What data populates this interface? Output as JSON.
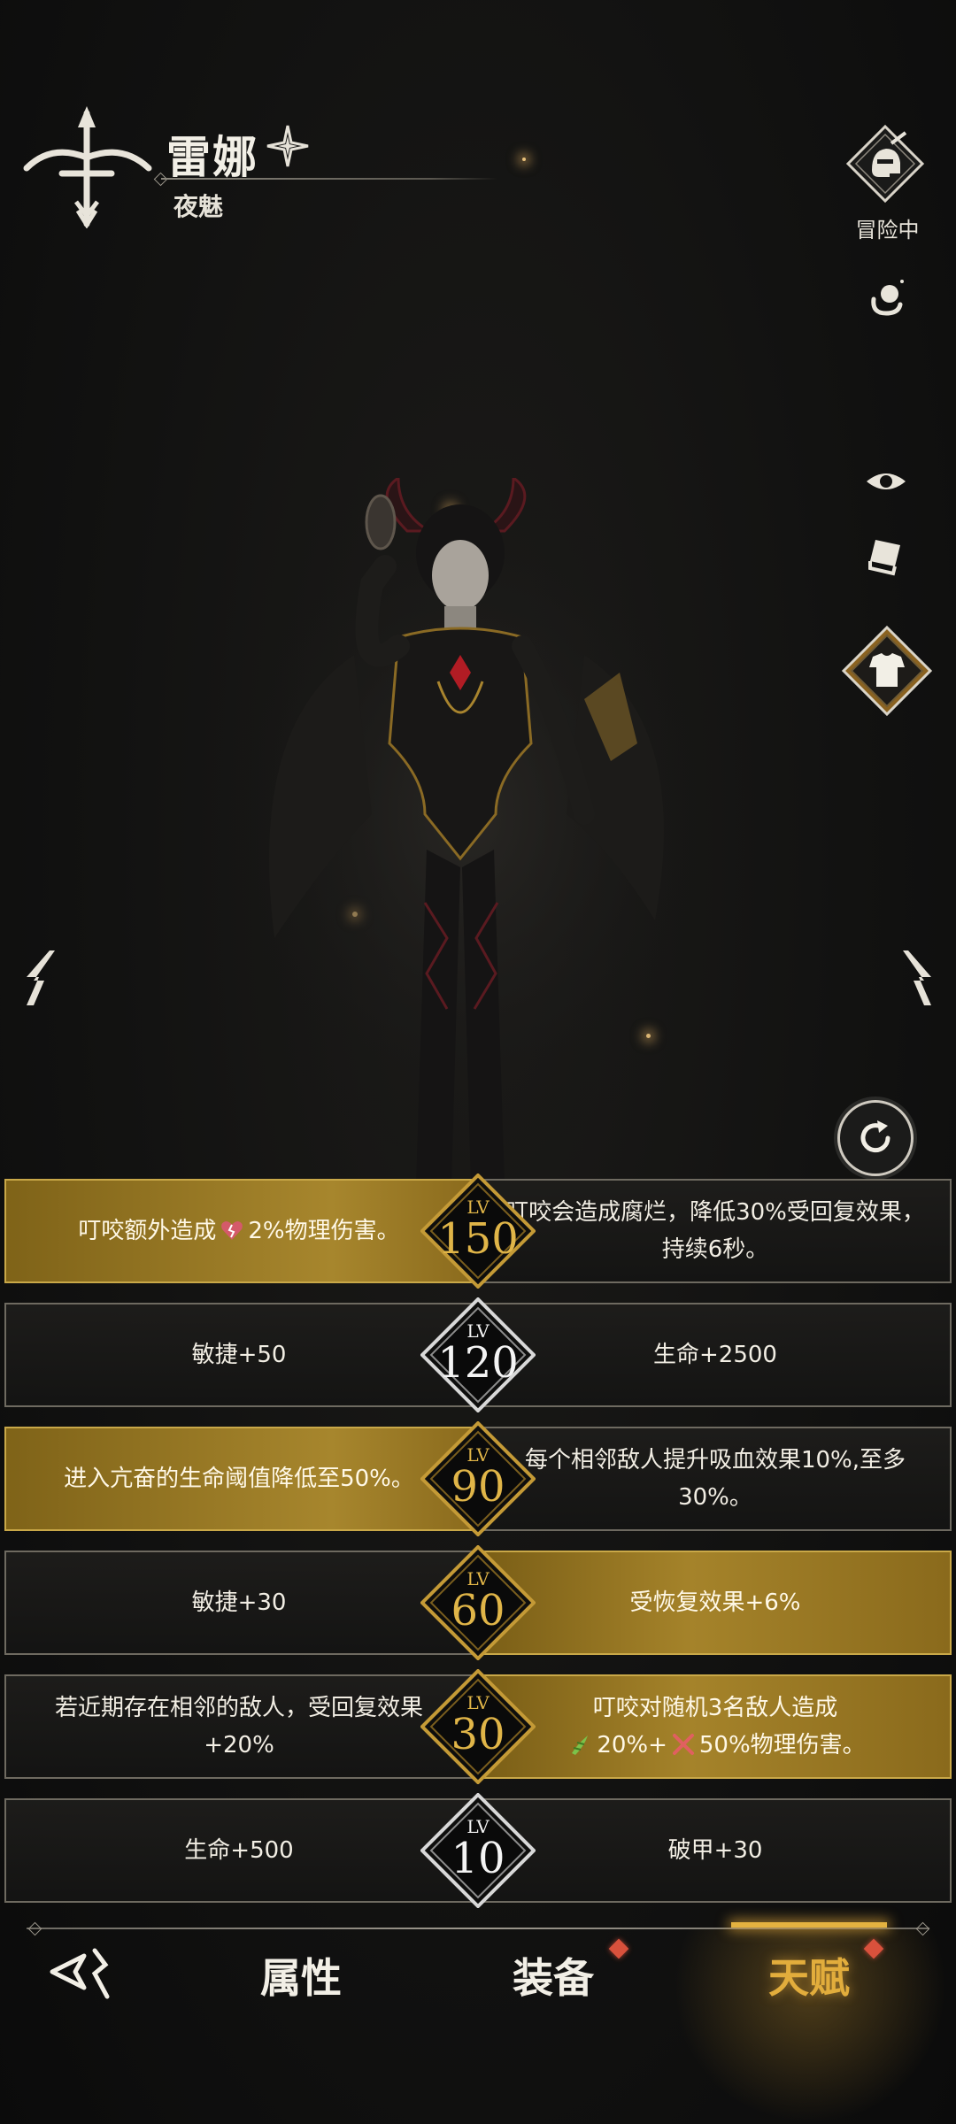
{
  "header": {
    "hero_name": "雷娜",
    "hero_title": "夜魅",
    "status_label": "冒险中"
  },
  "talents": [
    {
      "level_label": "LV",
      "level": "150",
      "left_text_before_icon": "叮咬额外造成",
      "left_text_after_icon": "2%物理伤害。",
      "left_icon": "broken-heart-icon",
      "right_text": "叮咬会造成腐烂，降低30%受回复效果，持续6秒。",
      "left_style": "gold",
      "right_style": "dark",
      "badge_style": "gold"
    },
    {
      "level_label": "LV",
      "level": "120",
      "left_text": "敏捷+50",
      "right_text": "生命+2500",
      "left_style": "dark",
      "right_style": "dark",
      "badge_style": "silver"
    },
    {
      "level_label": "LV",
      "level": "90",
      "left_text": "进入亢奋的生命阈值降低至50%。",
      "right_text": "每个相邻敌人提升吸血效果10%,至多30%。",
      "left_style": "gold",
      "right_style": "dark",
      "badge_style": "gold"
    },
    {
      "level_label": "LV",
      "level": "60",
      "left_text": "敏捷+30",
      "right_text": "受恢复效果+6%",
      "left_style": "dark",
      "right_style": "gold",
      "badge_style": "gold"
    },
    {
      "level_label": "LV",
      "level": "30",
      "left_text": "若近期存在相邻的敌人，受回复效果+20%",
      "right_text_line1": "叮咬对随机3名敌人造成",
      "right_text_part_a": "20%+",
      "right_text_part_b": "50%物理伤害。",
      "right_icon_a": "green-vine-icon",
      "right_icon_b": "red-swords-icon",
      "left_style": "dark",
      "right_style": "gold",
      "badge_style": "gold"
    },
    {
      "level_label": "LV",
      "level": "10",
      "left_text": "生命+500",
      "right_text": "破甲+30",
      "left_style": "dark",
      "right_style": "dark",
      "badge_style": "silver"
    }
  ],
  "tabs": [
    {
      "label": "属性",
      "active": false
    },
    {
      "label": "装备",
      "active": false,
      "alert": true
    },
    {
      "label": "天赋",
      "active": true,
      "alert": true
    }
  ],
  "colors": {
    "gold": "#a5832a",
    "gold_text": "#e0b548",
    "active_tab": "#e4b240",
    "alert": "#d9513c",
    "background": "#121211"
  }
}
